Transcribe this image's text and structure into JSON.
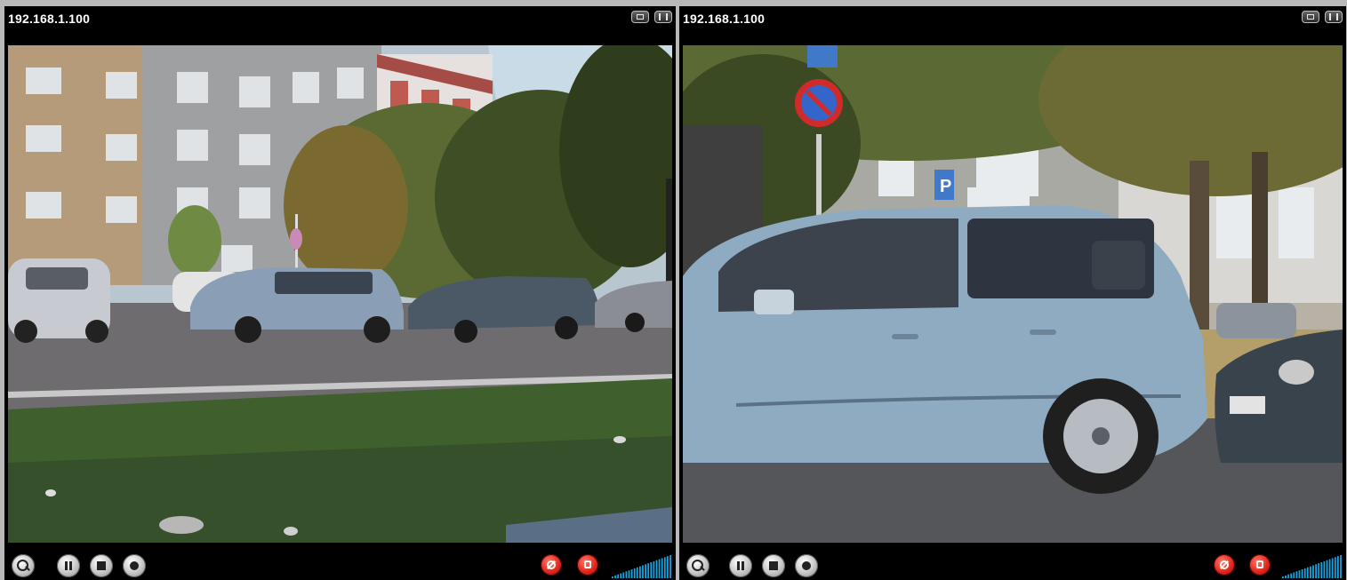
{
  "panes": [
    {
      "title": "192.168.1.100",
      "title_icons": [
        "window-icon",
        "fullscreen-icon"
      ],
      "controls": [
        "zoom-icon",
        "pause-icon",
        "stop-icon",
        "record-icon"
      ],
      "audio_controls": [
        "mute-icon",
        "speaker-icon"
      ],
      "volume_level": 1.0
    },
    {
      "title": "192.168.1.100",
      "title_icons": [
        "window-icon",
        "fullscreen-icon"
      ],
      "controls": [
        "zoom-icon",
        "pause-icon",
        "stop-icon",
        "record-icon"
      ],
      "audio_controls": [
        "mute-icon",
        "speaker-icon"
      ],
      "volume_level": 1.0
    }
  ],
  "colors": {
    "background": "#b9b9b9",
    "bar": "#000000",
    "title_text": "#ffffff",
    "audio_button": "#e0261a",
    "volume_bar": "#19a4e0"
  }
}
